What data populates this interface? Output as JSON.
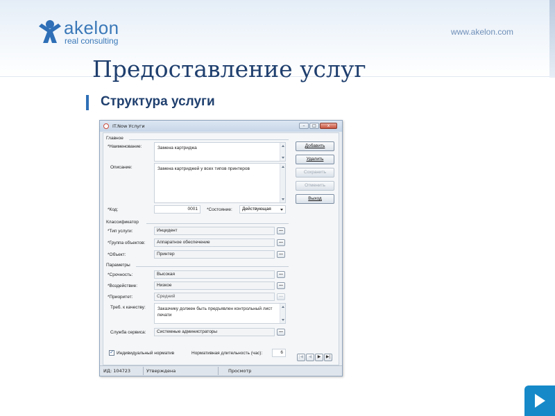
{
  "header": {
    "brand_name": "akelon",
    "brand_tagline": "real consulting",
    "site_url": "www.akelon.com"
  },
  "slide": {
    "title": "Предоставление услуг",
    "subtitle": "Структура услуги"
  },
  "colors": {
    "brand_blue": "#3a78b8",
    "title_navy": "#1f3f6e",
    "accent_blue": "#1689c9"
  },
  "window": {
    "title": "IT.Now Услуги",
    "controls": {
      "minimize": "–",
      "maximize": "□",
      "close": "x"
    },
    "sections": {
      "main": "Главное",
      "classifier": "Классификатор",
      "parameters": "Параметры"
    },
    "labels": {
      "name": "*Наименование:",
      "description": "Описание:",
      "code": "*Код:",
      "state": "*Состояние:",
      "service_type": "*Тип услуги:",
      "object_group": "*Группа объектов:",
      "object": "*Объект:",
      "urgency": "*Срочность:",
      "impact": "*Воздействие:",
      "priority": "*Приоритет:",
      "quality_req": "Треб. к качеству:",
      "service_desk": "Служба сервиса:",
      "individual_norm": "Индивидуальный норматив",
      "norm_duration": "Нормативная длительность (час):"
    },
    "values": {
      "name": "Замена картриджа",
      "description": "Замена картриджей у всех типов принтеров",
      "code": "0001",
      "state": "Действующая",
      "service_type": "Инцидент",
      "object_group": "Аппаратное обеспечение",
      "object": "Принтер",
      "urgency": "Высокая",
      "impact": "Низкое",
      "priority": "Средний",
      "quality_req": "Заказчику должен быть предъявлен контрольный лист печати",
      "service_desk": "Системные администраторы",
      "norm_duration": "6",
      "individual_norm_checked": true,
      "ellipsis": "..."
    },
    "buttons": {
      "add": "Добавить",
      "delete": "Удалить",
      "save": "Сохранить",
      "cancel": "Отменить",
      "exit": "Выход"
    },
    "nav": {
      "first": "|◀",
      "prev": "◀",
      "next": "▶",
      "last": "▶|"
    },
    "status": {
      "id": "ИД: 104723",
      "state": "Утверждена",
      "mode": "Просмотр"
    }
  }
}
